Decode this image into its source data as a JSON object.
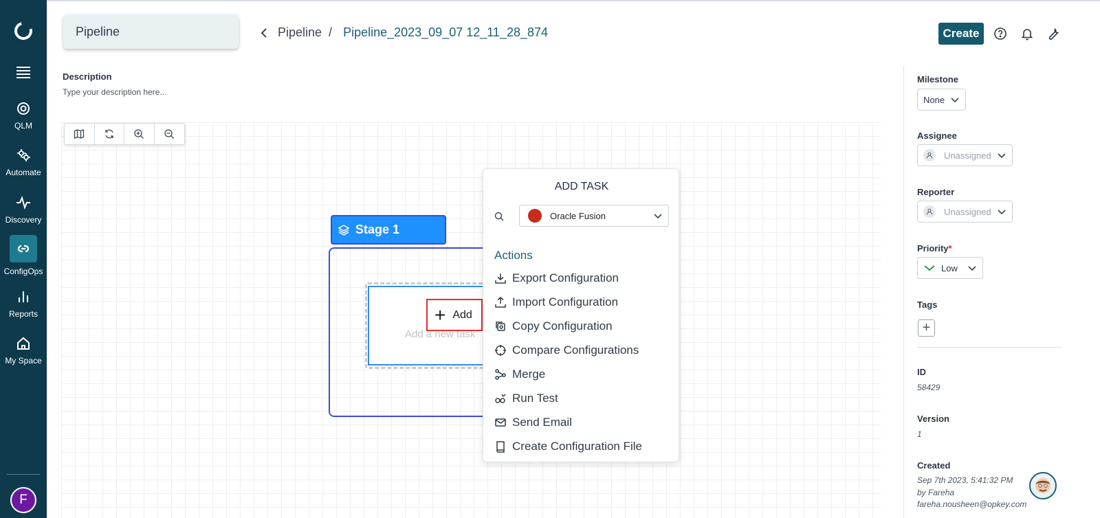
{
  "sidebar": {
    "items": [
      {
        "label": "QLM"
      },
      {
        "label": "Automate"
      },
      {
        "label": "Discovery"
      },
      {
        "label": "ConfigOps"
      },
      {
        "label": "Reports"
      },
      {
        "label": "My Space"
      }
    ],
    "avatar_initial": "F"
  },
  "header": {
    "title": "Pipeline",
    "breadcrumb_parent": "Pipeline",
    "breadcrumb_separator": "/",
    "breadcrumb_current": "Pipeline_2023_09_07 12_11_28_874",
    "create_label": "Create"
  },
  "description": {
    "label": "Description",
    "placeholder": "Type your description here..."
  },
  "canvas": {
    "stage_title": "Stage 1",
    "add_label": "Add",
    "add_hint": "Add a new task"
  },
  "add_task_popup": {
    "title": "ADD TASK",
    "selected_app": "Oracle Fusion",
    "actions_title": "Actions",
    "actions": [
      {
        "label": "Export Configuration",
        "icon": "download-icon"
      },
      {
        "label": "Import Configuration",
        "icon": "upload-icon"
      },
      {
        "label": "Copy Configuration",
        "icon": "copy-icon"
      },
      {
        "label": "Compare Configurations",
        "icon": "compare-icon"
      },
      {
        "label": "Merge",
        "icon": "merge-icon"
      },
      {
        "label": "Run Test",
        "icon": "run-test-icon"
      },
      {
        "label": "Send Email",
        "icon": "mail-icon"
      },
      {
        "label": "Create Configuration File",
        "icon": "book-icon"
      }
    ]
  },
  "details": {
    "milestone_label": "Milestone",
    "milestone_value": "None",
    "assignee_label": "Assignee",
    "assignee_value": "Unassigned",
    "reporter_label": "Reporter",
    "reporter_value": "Unassigned",
    "priority_label": "Priority",
    "priority_required": "*",
    "priority_value": "Low",
    "tags_label": "Tags",
    "id_label": "ID",
    "id_value": "58429",
    "version_label": "Version",
    "version_value": "1",
    "created_label": "Created",
    "created_date": "Sep 7th 2023, 5:41:32 PM",
    "created_by": "by Fareha",
    "created_email": "fareha.nousheen@opkey.com"
  },
  "colors": {
    "sidebar_bg": "#0e3a4c",
    "accent": "#155a6e",
    "stage_blue": "#1e90ff",
    "highlight_red": "#e02d2d",
    "priority_low": "#22a04b"
  }
}
